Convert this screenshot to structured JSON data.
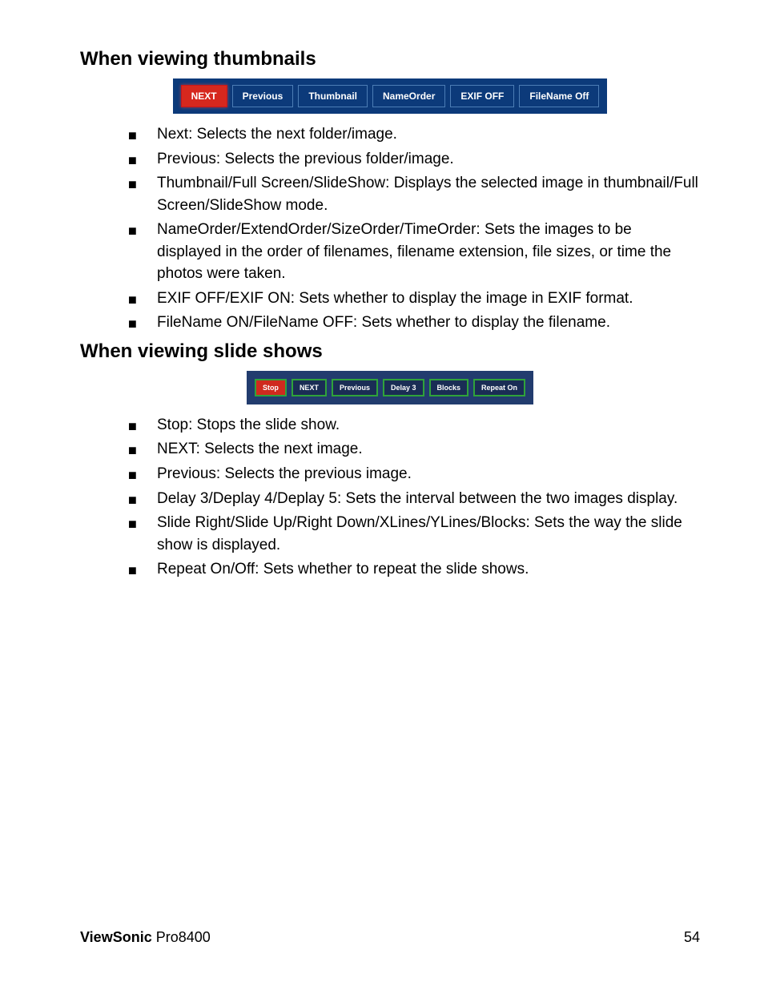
{
  "section1": {
    "heading": "When viewing thumbnails",
    "toolbar": {
      "btn1": "NEXT",
      "btn2": "Previous",
      "btn3": "Thumbnail",
      "btn4": "NameOrder",
      "btn5": "EXIF OFF",
      "btn6": "FileName Off"
    },
    "items": [
      "Next: Selects the next folder/image.",
      "Previous: Selects the previous folder/image.",
      "Thumbnail/Full Screen/SlideShow: Displays the selected image in thumbnail/Full Screen/SlideShow mode.",
      "NameOrder/ExtendOrder/SizeOrder/TimeOrder: Sets the images to be displayed in the order of filenames, filename extension, file sizes, or time the photos were taken.",
      "EXIF OFF/EXIF ON: Sets whether to display the image in EXIF format.",
      "FileName ON/FileName OFF: Sets whether to display the filename."
    ]
  },
  "section2": {
    "heading": "When viewing slide shows",
    "toolbar": {
      "btn1": "Stop",
      "btn2": "NEXT",
      "btn3": "Previous",
      "btn4": "Delay 3",
      "btn5": "Blocks",
      "btn6": "Repeat On"
    },
    "items": [
      "Stop: Stops the slide show.",
      "NEXT: Selects the next image.",
      "Previous: Selects the previous image.",
      "Delay 3/Deplay 4/Deplay 5: Sets the interval between the two images display.",
      "Slide Right/Slide Up/Right Down/XLines/YLines/Blocks: Sets the way the slide show is  displayed.",
      "Repeat On/Off: Sets whether to repeat the slide shows."
    ]
  },
  "footer": {
    "brand": "ViewSonic",
    "model": "Pro8400",
    "page": "54"
  }
}
